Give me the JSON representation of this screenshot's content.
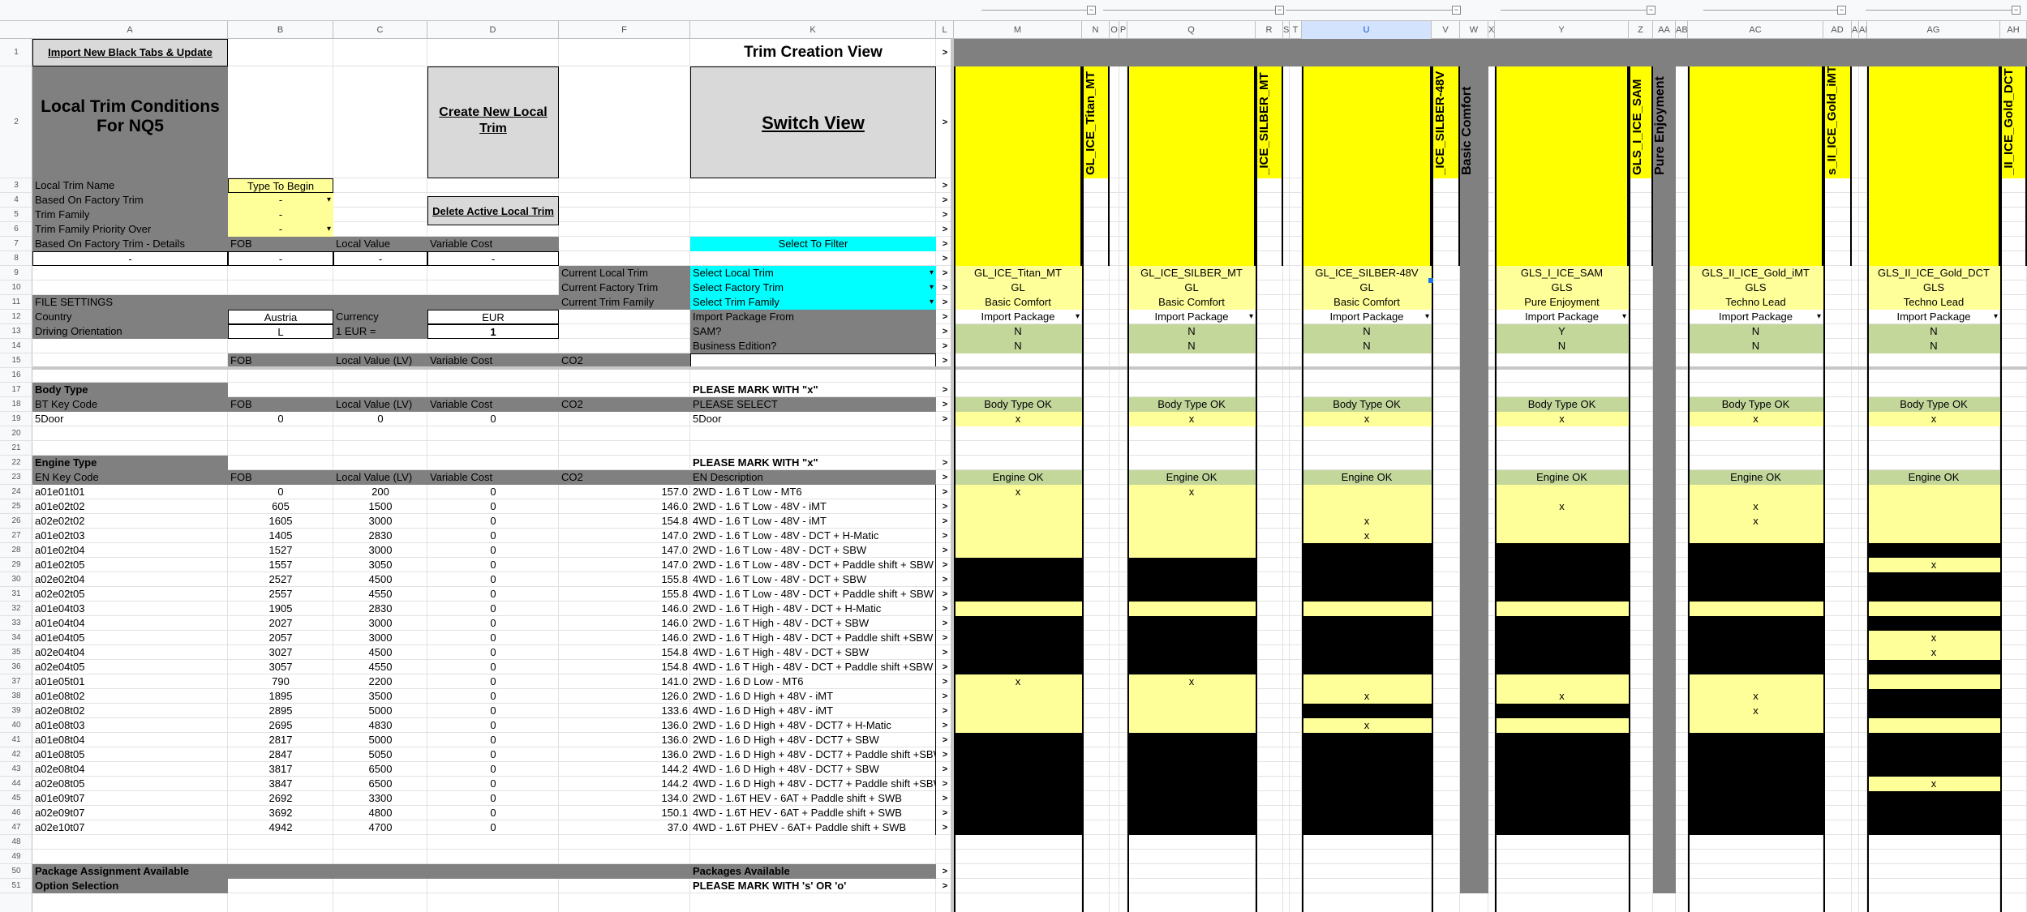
{
  "columns": [
    "A",
    "B",
    "C",
    "D",
    "F",
    "K",
    "L",
    "M",
    "N",
    "O",
    "P",
    "Q",
    "R",
    "S",
    "T",
    "U",
    "V",
    "W",
    "X",
    "Y",
    "Z",
    "AA",
    "AB",
    "AC",
    "AD",
    "AE",
    "AF",
    "AG",
    "AH"
  ],
  "rows": [
    "1",
    "2",
    "3",
    "4",
    "5",
    "6",
    "7",
    "8",
    "9",
    "10",
    "11",
    "12",
    "13",
    "14",
    "15",
    "16",
    "17",
    "18",
    "19",
    "20",
    "21",
    "22",
    "23",
    "24",
    "25",
    "26",
    "27",
    "28",
    "29",
    "30",
    "31",
    "32",
    "33",
    "34",
    "35",
    "36",
    "37",
    "38",
    "39",
    "40",
    "41",
    "42",
    "43",
    "44",
    "45",
    "46",
    "47",
    "48",
    "49",
    "50",
    "51"
  ],
  "top": {
    "import_button": "Import New Black Tabs & Update",
    "title": "Local Trim Conditions For NQ5",
    "create_button": "Create New Local Trim",
    "switch_button": "Switch View",
    "view_title": "Trim Creation View",
    "delete_button": "Delete Active Local Trim",
    "select_to_filter": "Select To Filter"
  },
  "settings": {
    "local_trim_name_label": "Local Trim Name",
    "local_trim_name_value": "Type To Begin",
    "based_on_label": "Based On Factory Trim",
    "based_on_value": "-",
    "trim_family_label": "Trim Family",
    "trim_family_value": "-",
    "priority_label": "Trim Family Priority Over",
    "priority_value": "-",
    "details_label": "Based On Factory Trim - Details",
    "fob": "FOB",
    "local_value": "Local Value",
    "variable_cost": "Variable Cost",
    "dash": "-",
    "current_local_trim": "Current Local Trim",
    "current_factory_trim": "Current Factory Trim",
    "current_trim_family": "Current Trim Family",
    "select_local_trim": "Select Local Trim",
    "select_factory_trim": "Select Factory Trim",
    "select_trim_family": "Select Trim Family",
    "file_settings": "FILE SETTINGS",
    "country_label": "Country",
    "country_value": "Austria",
    "currency_label": "Currency",
    "currency_value": "EUR",
    "driving_label": "Driving Orientation",
    "driving_value": "L",
    "eur_label": "1 EUR =",
    "eur_value": "1",
    "import_package_from": "Import Package From",
    "sam": "SAM?",
    "business": "Business Edition?",
    "lv": "Local Value (LV)",
    "co2": "CO2"
  },
  "body": {
    "section": "Body Type",
    "key_label": "BT Key Code",
    "mark_hint": "PLEASE MARK WITH \"x\"",
    "please_select": "PLEASE SELECT",
    "row_code": "5Door",
    "row_fob": "0",
    "row_lv": "0",
    "row_vc": "0",
    "row_desc": "5Door"
  },
  "engine": {
    "section": "Engine Type",
    "key_label": "EN Key Code",
    "desc_label": "EN Description",
    "rows": [
      {
        "row": "24",
        "code": "a01e01t01",
        "fob": "0",
        "lv": "200",
        "vc": "0",
        "co2": "157.0",
        "desc": "2WD - 1.6 T Low - MT6"
      },
      {
        "row": "25",
        "code": "a01e02t02",
        "fob": "605",
        "lv": "1500",
        "vc": "0",
        "co2": "146.0",
        "desc": "2WD - 1.6 T Low - 48V - iMT"
      },
      {
        "row": "26",
        "code": "a02e02t02",
        "fob": "1605",
        "lv": "3000",
        "vc": "0",
        "co2": "154.8",
        "desc": "4WD - 1.6 T Low - 48V - iMT"
      },
      {
        "row": "27",
        "code": "a01e02t03",
        "fob": "1405",
        "lv": "2830",
        "vc": "0",
        "co2": "147.0",
        "desc": "2WD - 1.6 T Low - 48V - DCT + H-Matic"
      },
      {
        "row": "28",
        "code": "a01e02t04",
        "fob": "1527",
        "lv": "3000",
        "vc": "0",
        "co2": "147.0",
        "desc": "2WD - 1.6 T Low - 48V - DCT + SBW"
      },
      {
        "row": "29",
        "code": "a01e02t05",
        "fob": "1557",
        "lv": "3050",
        "vc": "0",
        "co2": "147.0",
        "desc": "2WD - 1.6 T Low - 48V - DCT + Paddle shift + SBW"
      },
      {
        "row": "30",
        "code": "a02e02t04",
        "fob": "2527",
        "lv": "4500",
        "vc": "0",
        "co2": "155.8",
        "desc": "4WD - 1.6 T Low - 48V - DCT + SBW"
      },
      {
        "row": "31",
        "code": "a02e02t05",
        "fob": "2557",
        "lv": "4550",
        "vc": "0",
        "co2": "155.8",
        "desc": "4WD - 1.6 T Low - 48V - DCT + Paddle shift + SBW"
      },
      {
        "row": "32",
        "code": "a01e04t03",
        "fob": "1905",
        "lv": "2830",
        "vc": "0",
        "co2": "146.0",
        "desc": "2WD - 1.6 T High - 48V - DCT + H-Matic"
      },
      {
        "row": "33",
        "code": "a01e04t04",
        "fob": "2027",
        "lv": "3000",
        "vc": "0",
        "co2": "146.0",
        "desc": "2WD - 1.6 T High - 48V - DCT + SBW"
      },
      {
        "row": "34",
        "code": "a01e04t05",
        "fob": "2057",
        "lv": "3000",
        "vc": "0",
        "co2": "146.0",
        "desc": "2WD - 1.6 T High - 48V - DCT + Paddle shift +SBW"
      },
      {
        "row": "35",
        "code": "a02e04t04",
        "fob": "3027",
        "lv": "4500",
        "vc": "0",
        "co2": "154.8",
        "desc": "4WD - 1.6 T High - 48V - DCT + SBW"
      },
      {
        "row": "36",
        "code": "a02e04t05",
        "fob": "3057",
        "lv": "4550",
        "vc": "0",
        "co2": "154.8",
        "desc": "4WD - 1.6 T High - 48V - DCT + Paddle shift +SBW"
      },
      {
        "row": "37",
        "code": "a01e05t01",
        "fob": "790",
        "lv": "2200",
        "vc": "0",
        "co2": "141.0",
        "desc": "2WD - 1.6 D Low - MT6"
      },
      {
        "row": "38",
        "code": "a01e08t02",
        "fob": "1895",
        "lv": "3500",
        "vc": "0",
        "co2": "126.0",
        "desc": "2WD - 1.6 D High + 48V - iMT"
      },
      {
        "row": "39",
        "code": "a02e08t02",
        "fob": "2895",
        "lv": "5000",
        "vc": "0",
        "co2": "133.6",
        "desc": "4WD - 1.6 D High + 48V - iMT"
      },
      {
        "row": "40",
        "code": "a01e08t03",
        "fob": "2695",
        "lv": "4830",
        "vc": "0",
        "co2": "136.0",
        "desc": "2WD - 1.6 D High + 48V - DCT7 + H-Matic"
      },
      {
        "row": "41",
        "code": "a01e08t04",
        "fob": "2817",
        "lv": "5000",
        "vc": "0",
        "co2": "136.0",
        "desc": "2WD - 1.6 D High + 48V - DCT7 + SBW"
      },
      {
        "row": "42",
        "code": "a01e08t05",
        "fob": "2847",
        "lv": "5050",
        "vc": "0",
        "co2": "136.0",
        "desc": "2WD - 1.6 D High + 48V - DCT7 + Paddle shift +SBW"
      },
      {
        "row": "43",
        "code": "a02e08t04",
        "fob": "3817",
        "lv": "6500",
        "vc": "0",
        "co2": "144.2",
        "desc": "4WD - 1.6 D High + 48V - DCT7 + SBW"
      },
      {
        "row": "44",
        "code": "a02e08t05",
        "fob": "3847",
        "lv": "6500",
        "vc": "0",
        "co2": "144.2",
        "desc": "4WD - 1.6 D High + 48V - DCT7 + Paddle shift +SBW"
      },
      {
        "row": "45",
        "code": "a01e09t07",
        "fob": "2692",
        "lv": "3300",
        "vc": "0",
        "co2": "134.0",
        "desc": "2WD - 1.6T HEV - 6AT + Paddle shift + SWB"
      },
      {
        "row": "46",
        "code": "a02e09t07",
        "fob": "3692",
        "lv": "4800",
        "vc": "0",
        "co2": "150.1",
        "desc": "4WD - 1.6T HEV - 6AT + Paddle shift + SWB"
      },
      {
        "row": "47",
        "code": "a02e10t07",
        "fob": "4942",
        "lv": "4700",
        "vc": "0",
        "co2": "37.0",
        "desc": "4WD - 1.6T PHEV - 6AT+ Paddle shift + SWB"
      }
    ]
  },
  "footer": {
    "package_assign": "Package Assignment Available",
    "packages_available": "Packages Available",
    "option_selection": "Option Selection",
    "option_hint": "PLEASE MARK WITH 's' OR 'o'"
  },
  "arrow": ">",
  "trims": [
    {
      "vertical": "GL_ICE_Titan_MT",
      "name": "GL_ICE_Titan_MT",
      "family": "GL",
      "package": "Basic Comfort",
      "import": "Import Package",
      "sam": "N",
      "business": "N",
      "body_ok": "Body Type OK",
      "body_mark": "x",
      "engine_ok": "Engine OK",
      "marks": {
        "24": "x",
        "37": "x"
      },
      "black": [
        "29",
        "30",
        "31",
        "33",
        "34",
        "35",
        "36",
        "41",
        "42",
        "43",
        "44",
        "45",
        "46",
        "47"
      ]
    },
    {
      "vertical": "_ICE_SILBER_MT",
      "name": "GL_ICE_SILBER_MT",
      "family": "GL",
      "package": "Basic Comfort",
      "import": "Import Package",
      "sam": "N",
      "business": "N",
      "body_ok": "Body Type OK",
      "body_mark": "x",
      "engine_ok": "Engine OK",
      "marks": {
        "24": "x",
        "37": "x"
      },
      "black": [
        "29",
        "30",
        "31",
        "33",
        "34",
        "35",
        "36",
        "41",
        "42",
        "43",
        "44",
        "45",
        "46",
        "47"
      ]
    },
    {
      "vertical": "_ICE_SILBER-48V",
      "name": "GL_ICE_SILBER-48V",
      "family": "GL",
      "package": "Basic Comfort",
      "import": "Import Package",
      "sam": "N",
      "business": "N",
      "body_ok": "Body Type OK",
      "body_mark": "x",
      "engine_ok": "Engine OK",
      "marks": {
        "26": "x",
        "27": "x",
        "38": "x",
        "40": "x"
      },
      "black": [
        "28",
        "29",
        "30",
        "31",
        "33",
        "34",
        "35",
        "36",
        "39",
        "41",
        "42",
        "43",
        "44",
        "45",
        "46",
        "47"
      ]
    },
    {
      "vertical": "GLS_I_ICE_SAM",
      "name": "GLS_I_ICE_SAM",
      "family": "GLS",
      "package": "Pure Enjoyment",
      "import": "Import Package",
      "sam": "Y",
      "business": "N",
      "body_ok": "Body Type OK",
      "body_mark": "x",
      "engine_ok": "Engine OK",
      "marks": {
        "25": "x",
        "38": "x"
      },
      "black": [
        "28",
        "29",
        "30",
        "31",
        "33",
        "34",
        "35",
        "36",
        "39",
        "41",
        "42",
        "43",
        "44",
        "45",
        "46",
        "47"
      ]
    },
    {
      "vertical": "s_II_ICE_Gold_iMT",
      "name": "GLS_II_ICE_Gold_iMT",
      "family": "GLS",
      "package": "Techno Lead",
      "import": "Import Package",
      "sam": "N",
      "business": "N",
      "body_ok": "Body Type OK",
      "body_mark": "x",
      "engine_ok": "Engine OK",
      "marks": {
        "25": "x",
        "26": "x",
        "38": "x",
        "39": "x"
      },
      "black": [
        "28",
        "29",
        "30",
        "31",
        "33",
        "34",
        "35",
        "36",
        "41",
        "42",
        "43",
        "44",
        "45",
        "46",
        "47"
      ]
    },
    {
      "vertical": "_II_ICE_Gold_DCT",
      "name": "GLS_II_ICE_Gold_DCT",
      "family": "GLS",
      "package": "Techno Lead",
      "import": "Import Package",
      "sam": "N",
      "business": "N",
      "body_ok": "Body Type OK",
      "body_mark": "x",
      "engine_ok": "Engine OK",
      "marks": {
        "29": "x",
        "34": "x",
        "35": "x",
        "44": "x"
      },
      "black": [
        "28",
        "30",
        "31",
        "33",
        "36",
        "38",
        "39",
        "41",
        "42",
        "43",
        "45",
        "46",
        "47"
      ]
    }
  ],
  "group_labels": [
    "Basic Comfort",
    "Pure Enjoyment"
  ],
  "colors": {
    "gray": "#808080",
    "yellow": "#ffff99",
    "cyan": "#00ffff",
    "green": "#c4d79b",
    "black": "#000000"
  }
}
